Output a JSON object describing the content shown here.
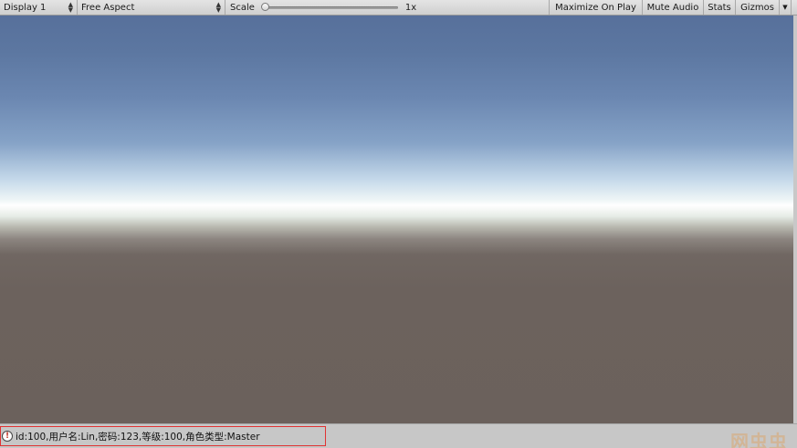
{
  "toolbar": {
    "display_label": "Display 1",
    "aspect_label": "Free Aspect",
    "scale_label": "Scale",
    "scale_value_label": "1x",
    "scale_level": 0.0,
    "maximize_label": "Maximize On Play",
    "mute_label": "Mute Audio",
    "stats_label": "Stats",
    "gizmos_label": "Gizmos"
  },
  "status_bar": {
    "log_message": "id:100,用户名:Lin,密码:123,等级:100,角色类型:Master",
    "log_icon": "warning-exclamation-icon",
    "highlight_color": "#e03333"
  },
  "watermark": "网虫虫"
}
